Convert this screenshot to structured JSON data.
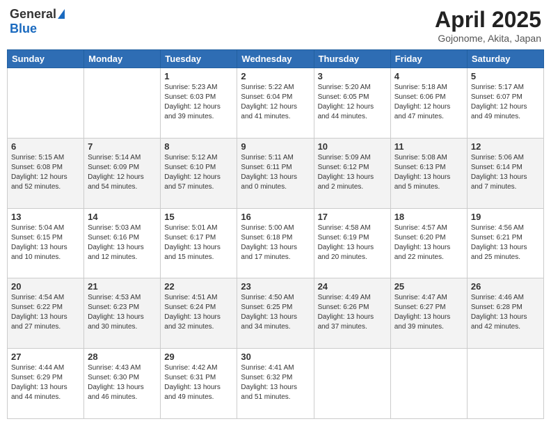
{
  "header": {
    "logo_general": "General",
    "logo_blue": "Blue",
    "title": "April 2025",
    "location": "Gojonome, Akita, Japan"
  },
  "days_of_week": [
    "Sunday",
    "Monday",
    "Tuesday",
    "Wednesday",
    "Thursday",
    "Friday",
    "Saturday"
  ],
  "weeks": [
    [
      {
        "day": "",
        "info": ""
      },
      {
        "day": "",
        "info": ""
      },
      {
        "day": "1",
        "info": "Sunrise: 5:23 AM\nSunset: 6:03 PM\nDaylight: 12 hours and 39 minutes."
      },
      {
        "day": "2",
        "info": "Sunrise: 5:22 AM\nSunset: 6:04 PM\nDaylight: 12 hours and 41 minutes."
      },
      {
        "day": "3",
        "info": "Sunrise: 5:20 AM\nSunset: 6:05 PM\nDaylight: 12 hours and 44 minutes."
      },
      {
        "day": "4",
        "info": "Sunrise: 5:18 AM\nSunset: 6:06 PM\nDaylight: 12 hours and 47 minutes."
      },
      {
        "day": "5",
        "info": "Sunrise: 5:17 AM\nSunset: 6:07 PM\nDaylight: 12 hours and 49 minutes."
      }
    ],
    [
      {
        "day": "6",
        "info": "Sunrise: 5:15 AM\nSunset: 6:08 PM\nDaylight: 12 hours and 52 minutes."
      },
      {
        "day": "7",
        "info": "Sunrise: 5:14 AM\nSunset: 6:09 PM\nDaylight: 12 hours and 54 minutes."
      },
      {
        "day": "8",
        "info": "Sunrise: 5:12 AM\nSunset: 6:10 PM\nDaylight: 12 hours and 57 minutes."
      },
      {
        "day": "9",
        "info": "Sunrise: 5:11 AM\nSunset: 6:11 PM\nDaylight: 13 hours and 0 minutes."
      },
      {
        "day": "10",
        "info": "Sunrise: 5:09 AM\nSunset: 6:12 PM\nDaylight: 13 hours and 2 minutes."
      },
      {
        "day": "11",
        "info": "Sunrise: 5:08 AM\nSunset: 6:13 PM\nDaylight: 13 hours and 5 minutes."
      },
      {
        "day": "12",
        "info": "Sunrise: 5:06 AM\nSunset: 6:14 PM\nDaylight: 13 hours and 7 minutes."
      }
    ],
    [
      {
        "day": "13",
        "info": "Sunrise: 5:04 AM\nSunset: 6:15 PM\nDaylight: 13 hours and 10 minutes."
      },
      {
        "day": "14",
        "info": "Sunrise: 5:03 AM\nSunset: 6:16 PM\nDaylight: 13 hours and 12 minutes."
      },
      {
        "day": "15",
        "info": "Sunrise: 5:01 AM\nSunset: 6:17 PM\nDaylight: 13 hours and 15 minutes."
      },
      {
        "day": "16",
        "info": "Sunrise: 5:00 AM\nSunset: 6:18 PM\nDaylight: 13 hours and 17 minutes."
      },
      {
        "day": "17",
        "info": "Sunrise: 4:58 AM\nSunset: 6:19 PM\nDaylight: 13 hours and 20 minutes."
      },
      {
        "day": "18",
        "info": "Sunrise: 4:57 AM\nSunset: 6:20 PM\nDaylight: 13 hours and 22 minutes."
      },
      {
        "day": "19",
        "info": "Sunrise: 4:56 AM\nSunset: 6:21 PM\nDaylight: 13 hours and 25 minutes."
      }
    ],
    [
      {
        "day": "20",
        "info": "Sunrise: 4:54 AM\nSunset: 6:22 PM\nDaylight: 13 hours and 27 minutes."
      },
      {
        "day": "21",
        "info": "Sunrise: 4:53 AM\nSunset: 6:23 PM\nDaylight: 13 hours and 30 minutes."
      },
      {
        "day": "22",
        "info": "Sunrise: 4:51 AM\nSunset: 6:24 PM\nDaylight: 13 hours and 32 minutes."
      },
      {
        "day": "23",
        "info": "Sunrise: 4:50 AM\nSunset: 6:25 PM\nDaylight: 13 hours and 34 minutes."
      },
      {
        "day": "24",
        "info": "Sunrise: 4:49 AM\nSunset: 6:26 PM\nDaylight: 13 hours and 37 minutes."
      },
      {
        "day": "25",
        "info": "Sunrise: 4:47 AM\nSunset: 6:27 PM\nDaylight: 13 hours and 39 minutes."
      },
      {
        "day": "26",
        "info": "Sunrise: 4:46 AM\nSunset: 6:28 PM\nDaylight: 13 hours and 42 minutes."
      }
    ],
    [
      {
        "day": "27",
        "info": "Sunrise: 4:44 AM\nSunset: 6:29 PM\nDaylight: 13 hours and 44 minutes."
      },
      {
        "day": "28",
        "info": "Sunrise: 4:43 AM\nSunset: 6:30 PM\nDaylight: 13 hours and 46 minutes."
      },
      {
        "day": "29",
        "info": "Sunrise: 4:42 AM\nSunset: 6:31 PM\nDaylight: 13 hours and 49 minutes."
      },
      {
        "day": "30",
        "info": "Sunrise: 4:41 AM\nSunset: 6:32 PM\nDaylight: 13 hours and 51 minutes."
      },
      {
        "day": "",
        "info": ""
      },
      {
        "day": "",
        "info": ""
      },
      {
        "day": "",
        "info": ""
      }
    ]
  ]
}
